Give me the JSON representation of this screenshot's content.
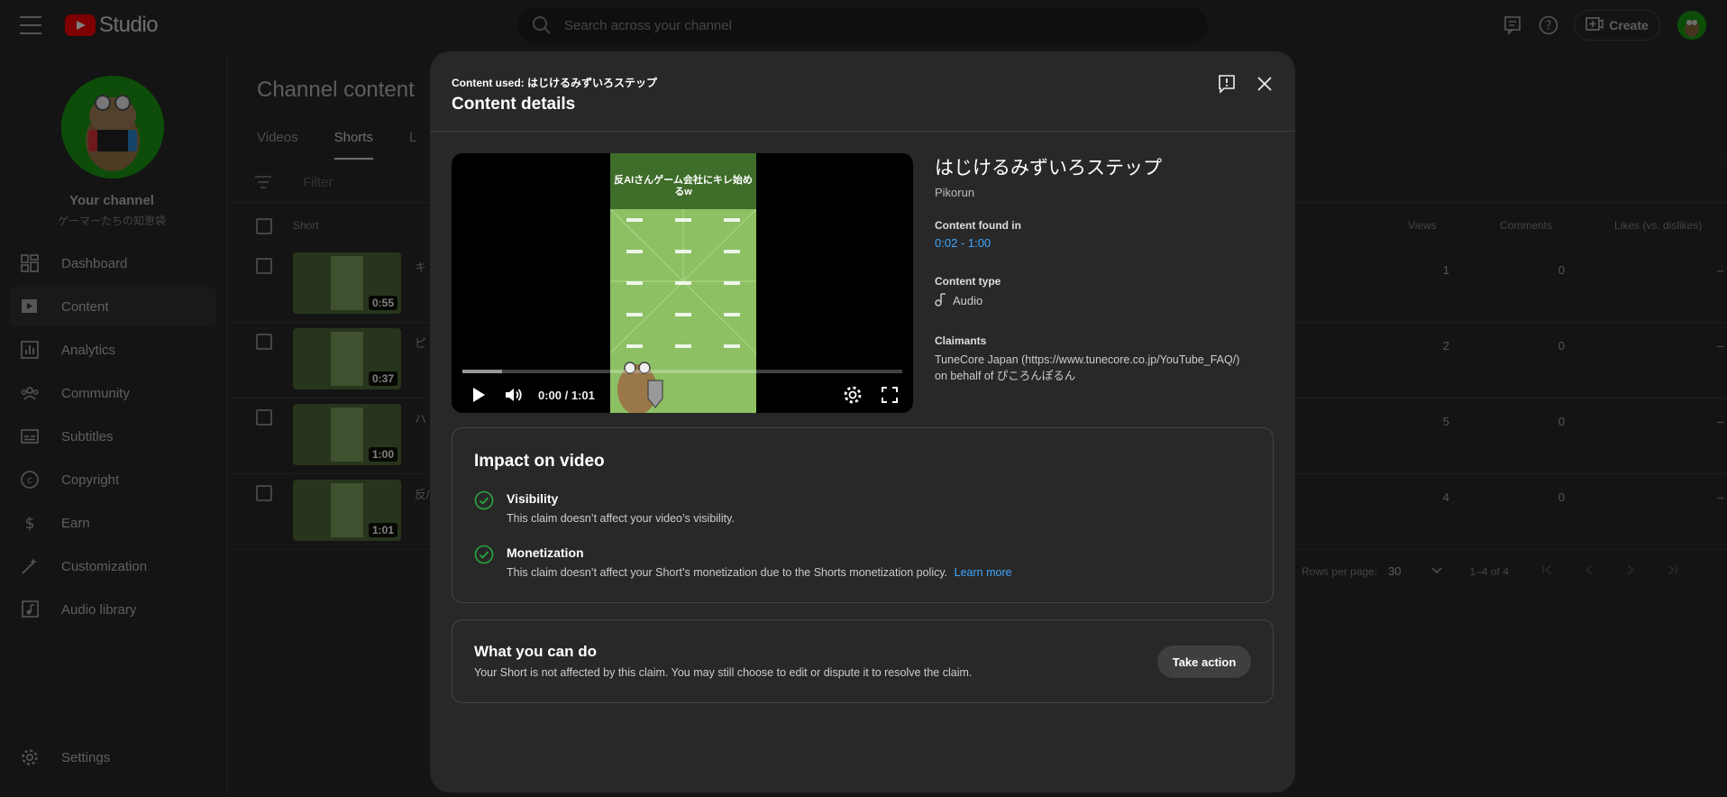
{
  "header": {
    "logo_text": "Studio",
    "search_placeholder": "Search across your channel",
    "create_label": "Create"
  },
  "sidebar": {
    "channel_title": "Your channel",
    "channel_handle": "ゲーマーたちの知恵袋",
    "items": [
      {
        "label": "Dashboard",
        "icon": "dashboard-icon"
      },
      {
        "label": "Content",
        "icon": "content-icon"
      },
      {
        "label": "Analytics",
        "icon": "analytics-icon"
      },
      {
        "label": "Community",
        "icon": "community-icon"
      },
      {
        "label": "Subtitles",
        "icon": "subtitles-icon"
      },
      {
        "label": "Copyright",
        "icon": "copyright-icon"
      },
      {
        "label": "Earn",
        "icon": "earn-icon"
      },
      {
        "label": "Customization",
        "icon": "customization-icon"
      },
      {
        "label": "Audio library",
        "icon": "audio-library-icon"
      }
    ],
    "settings_label": "Settings"
  },
  "page": {
    "title": "Channel content",
    "tabs": [
      "Videos",
      "Shorts",
      "L"
    ],
    "filter_placeholder": "Filter",
    "columns": {
      "short": "Short",
      "views": "Views",
      "comments": "Comments",
      "likes": "Likes (vs. dislikes)"
    },
    "rows": [
      {
        "title_char": "キ",
        "duration": "0:55",
        "views": "1",
        "comments": "0",
        "likes": "–"
      },
      {
        "title_char": "ピ",
        "duration": "0:37",
        "views": "2",
        "comments": "0",
        "likes": "–"
      },
      {
        "title_char": "ハ",
        "duration": "1:00",
        "views": "5",
        "comments": "0",
        "likes": "–"
      },
      {
        "title_char": "反/",
        "duration": "1:01",
        "views": "4",
        "comments": "0",
        "likes": "–"
      }
    ],
    "pagination": {
      "rows_per_page_label": "Rows per page:",
      "rows_per_page": "30",
      "range": "1–4 of 4"
    }
  },
  "dialog": {
    "content_used": "Content used: はじけるみずいろステップ",
    "title": "Content details",
    "video": {
      "banner_text": "反AIさんゲーム会社にキレ始めるw",
      "time": "0:00 / 1:01",
      "buffered_fraction": 0.09
    },
    "info": {
      "song_title": "はじけるみずいろステップ",
      "artist": "Pikorun",
      "found_label": "Content found in",
      "found_value": "0:02 - 1:00",
      "type_label": "Content type",
      "type_value": "Audio",
      "claimants_label": "Claimants",
      "claimant_line1": "TuneCore Japan (https://www.tunecore.co.jp/YouTube_FAQ/)",
      "claimant_line2": "on behalf of ぴころんぽるん"
    },
    "impact": {
      "title": "Impact on video",
      "visibility_title": "Visibility",
      "visibility_desc": "This claim doesn’t affect your video’s visibility.",
      "monetization_title": "Monetization",
      "monetization_desc": "This claim doesn’t affect your Short’s monetization due to the Shorts monetization policy.",
      "learn_more": "Learn more"
    },
    "actions": {
      "title": "What you can do",
      "desc": "Your Short is not affected by this claim. You may still choose to edit or dispute it to resolve the claim.",
      "button": "Take action"
    }
  },
  "colors": {
    "accent_link": "#3ea6ff",
    "check_green": "#2ba640",
    "brand_red": "#ff0000"
  }
}
